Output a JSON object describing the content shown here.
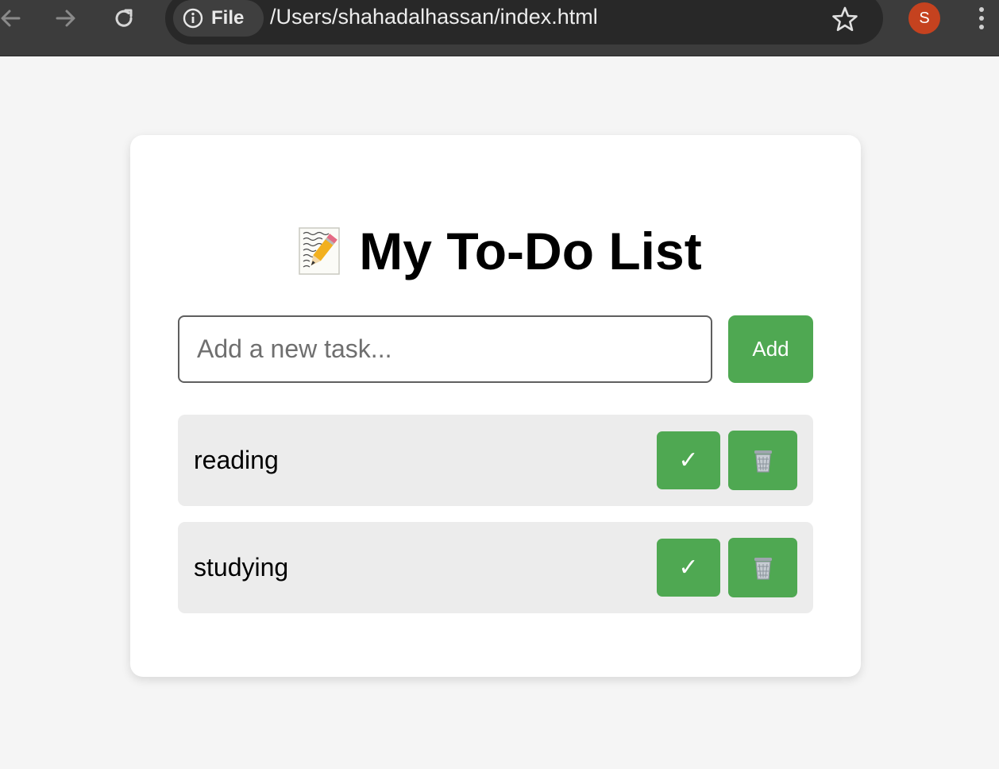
{
  "browser": {
    "site_chip_label": "File",
    "url": "/Users/shahadalhassan/index.html",
    "profile_initial": "S",
    "icons": [
      "back-arrow-icon",
      "forward-arrow-icon",
      "reload-icon",
      "info-icon",
      "star-icon",
      "more-menu-icon"
    ]
  },
  "app": {
    "title": "My To-Do List",
    "title_icon": "memo-icon",
    "input_placeholder": "Add a new task...",
    "input_value": "",
    "add_label": "Add",
    "tasks": [
      {
        "text": "reading",
        "done_label": "✓",
        "delete_icon": "trash-icon"
      },
      {
        "text": "studying",
        "done_label": "✓",
        "delete_icon": "trash-icon"
      }
    ]
  },
  "colors": {
    "accent_green": "#4fa852",
    "task_row_bg": "#ececec",
    "page_bg": "#f5f5f5",
    "chrome_bg": "#3c3c3c",
    "avatar_bg": "#c5421f"
  }
}
